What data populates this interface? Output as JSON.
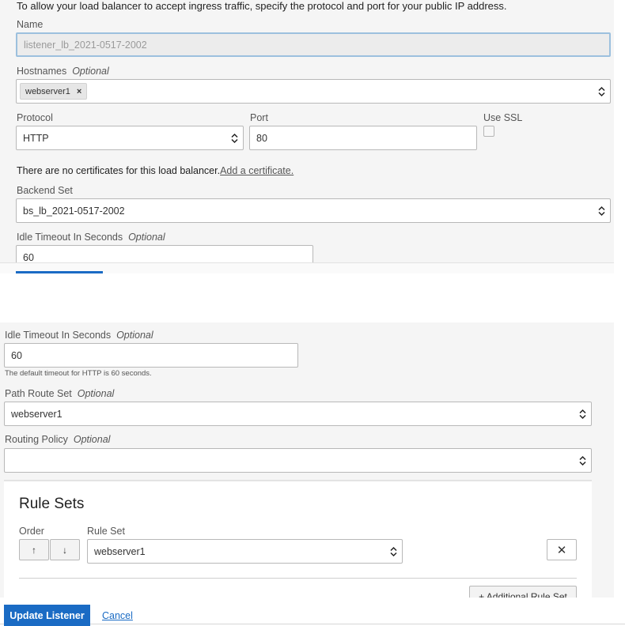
{
  "intro_text": "To allow your load balancer to accept ingress traffic, specify the protocol and port for your public IP address.",
  "name": {
    "label": "Name",
    "value": "listener_lb_2021-0517-2002"
  },
  "hostnames": {
    "label": "Hostnames",
    "optional": "Optional",
    "chips": [
      "webserver1"
    ],
    "chip_remove": "×"
  },
  "protocol": {
    "label": "Protocol",
    "value": "HTTP"
  },
  "port": {
    "label": "Port",
    "value": "80"
  },
  "ssl": {
    "label": "Use SSL",
    "checked": false
  },
  "cert_notice": {
    "text": "There are no certificates for this load balancer.",
    "link": "Add a certificate."
  },
  "backend_set": {
    "label": "Backend Set",
    "value": "bs_lb_2021-0517-2002"
  },
  "idle_timeout": {
    "label": "Idle Timeout In Seconds",
    "optional": "Optional",
    "value": "60",
    "help": "The default timeout for HTTP is 60 seconds."
  },
  "path_route_set": {
    "label": "Path Route Set",
    "optional": "Optional",
    "value": "webserver1"
  },
  "routing_policy": {
    "label": "Routing Policy",
    "optional": "Optional",
    "value": ""
  },
  "rule_sets": {
    "title": "Rule Sets",
    "order_label": "Order",
    "rule_set_label": "Rule Set",
    "up_glyph": "↑",
    "down_glyph": "↓",
    "value": "webserver1",
    "remove_glyph": "✕",
    "add_button": "+ Additional Rule Set"
  },
  "footer": {
    "update_button": "Update Listener",
    "cancel_link": "Cancel"
  },
  "colors": {
    "primary": "#1a6bc4",
    "panel_bg": "#f5f5f5",
    "border": "#b8b8b8"
  }
}
